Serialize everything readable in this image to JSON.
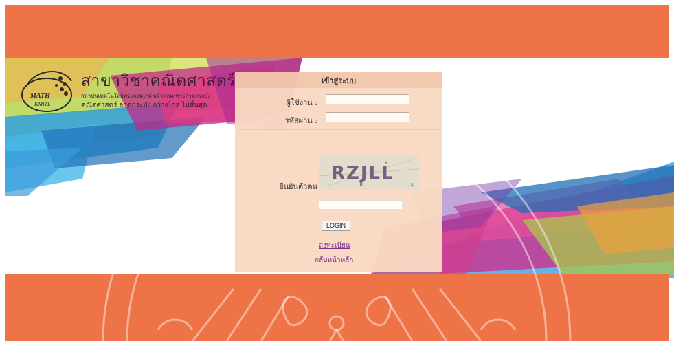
{
  "header": {
    "brand_title": "สาขาวิชาคณิตศาสตร์",
    "brand_sub1": "สถาบันเทคโนโลยีพระจอมเกล้าเจ้าคุณทหารลาดกระบัง",
    "brand_sub2": "คณิตศาสตร์ ลาดกระบัง กว้างไกล ไม่สิ้นสุด...",
    "logo_text_top": "MATH",
    "logo_text_bottom": "KMITL"
  },
  "login": {
    "title": "เข้าสู่ระบบ",
    "username_label": "ผู้ใช้งาน :",
    "password_label": "รหัสผ่าน :",
    "captcha_label": "ยืนยันตัวตน",
    "captcha_text": "RZJLL",
    "login_button": "LOGIN",
    "register_link": "ลงทะเบียน",
    "back_link": "กลับหน้าหลัก"
  },
  "colors": {
    "band": "#ee7346",
    "panel": "#f9d9c2",
    "panel_header": "#f2c7ac",
    "link": "#7a2a8a"
  }
}
